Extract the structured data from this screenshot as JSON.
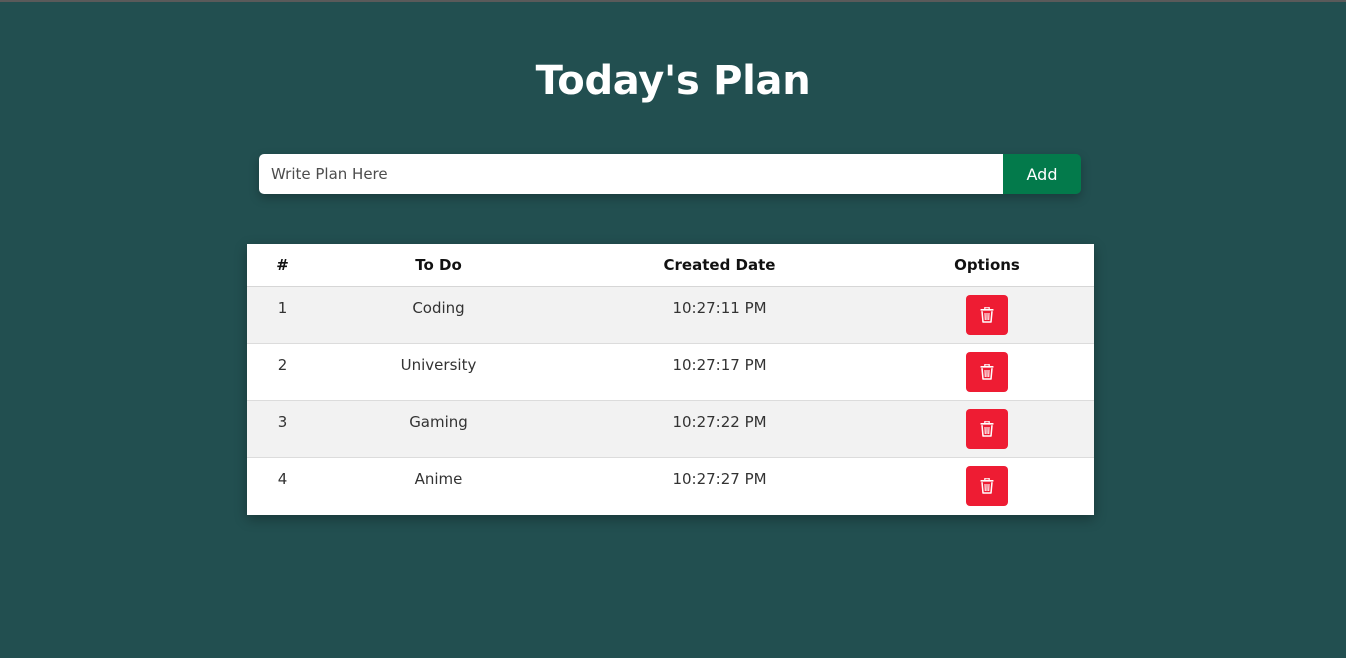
{
  "page": {
    "title": "Today's Plan"
  },
  "input": {
    "placeholder": "Write Plan Here",
    "value": "",
    "add_label": "Add"
  },
  "table": {
    "headers": [
      "#",
      "To Do",
      "Created Date",
      "Options"
    ],
    "rows": [
      {
        "num": "1",
        "todo": "Coding",
        "created": "10:27:11 PM",
        "option_icon": "trash-icon"
      },
      {
        "num": "2",
        "todo": "University",
        "created": "10:27:17 PM",
        "option_icon": "trash-icon"
      },
      {
        "num": "3",
        "todo": "Gaming",
        "created": "10:27:22 PM",
        "option_icon": "trash-icon"
      },
      {
        "num": "4",
        "todo": "Anime",
        "created": "10:27:27 PM",
        "option_icon": "trash-icon"
      }
    ]
  },
  "colors": {
    "background": "#224f50",
    "add_button": "#037a4b",
    "delete_button": "#ee1c33"
  }
}
